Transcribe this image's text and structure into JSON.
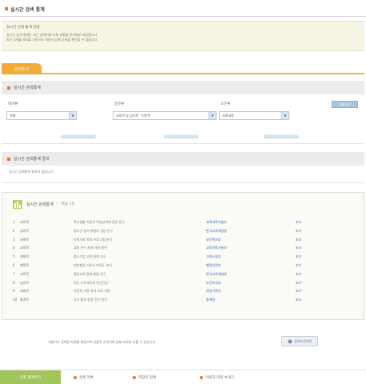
{
  "page": {
    "title": "실시간 검색 통계"
  },
  "notice": {
    "title": "실시간 검색 통계 안내",
    "lines": [
      "실시간 검색 통계는 최근 검색어와 조회 현황을 분야별로 제공합니다.",
      "최근 3개월 자료를 기준으로 이용자 검색 순위를 확인할 수 있습니다."
    ]
  },
  "tab": {
    "label": "검색조건"
  },
  "filter": {
    "title": "실시간 검색통계",
    "labels": [
      "대분류",
      "중분류",
      "소분류"
    ],
    "values": [
      "전체",
      "교육학 및 심리학 · 인문학",
      "사회과학"
    ],
    "search_button": "조회하기"
  },
  "result": {
    "title": "실시간 검색통계 결과",
    "message": "실시간 검색통계 결과가 없습니다."
  },
  "ranking": {
    "title": "실시간 검색통계",
    "subtitle": "Top 10",
    "rows": [
      {
        "num": "1",
        "cat": "교육학",
        "title": "학교생활 적응과 학업성취에 관한 연구",
        "org": "교육과학기술부",
        "link": "보기"
      },
      {
        "num": "2",
        "cat": "심리학",
        "title": "청소년 정서 발달과 상담 연구",
        "org": "한국교육개발원",
        "link": "보기"
      },
      {
        "num": "3",
        "cat": "사회학",
        "title": "지역사회 복지 프로그램 분석",
        "org": "보건복지부",
        "link": "보기"
      },
      {
        "num": "4",
        "cat": "교육학",
        "title": "교원 연수 체계 개선 방안",
        "org": "교육과학기술부",
        "link": "보기"
      },
      {
        "num": "5",
        "cat": "경제학",
        "title": "중소기업 고용 실태 조사",
        "org": "고용노동부",
        "link": "보기"
      },
      {
        "num": "6",
        "cat": "행정학",
        "title": "지방행정 서비스 만족도 조사",
        "org": "행정안전부",
        "link": "보기"
      },
      {
        "num": "7",
        "cat": "교육학",
        "title": "평생교육 참여 현황 연구",
        "org": "한국교육개발원",
        "link": "보기"
      },
      {
        "num": "8",
        "cat": "심리학",
        "title": "직무 스트레스와 정신건강",
        "org": "보건복지부",
        "link": "보기"
      },
      {
        "num": "9",
        "cat": "사회학",
        "title": "다문화 가정 자녀 교육 지원",
        "org": "여성가족부",
        "link": "보기"
      },
      {
        "num": "10",
        "cat": "통계학",
        "title": "국가 통계 품질 진단 연구",
        "org": "통계청",
        "link": "보기"
      }
    ]
  },
  "footer": {
    "note": "이용자가 검색한 자료를 바탕으로 산출된 순위이며 실제 자료와 다를 수 있습니다.",
    "apply_button": "검색조건저장"
  },
  "bottom": {
    "home": "대표 홈페이지",
    "links": [
      "검색 목록",
      "저장된 검색",
      "이용자 의견 보내기"
    ]
  },
  "colors": {
    "accent": "#f3ab36",
    "link": "#2b5fb5",
    "bottom_green": "#a1c45b"
  }
}
